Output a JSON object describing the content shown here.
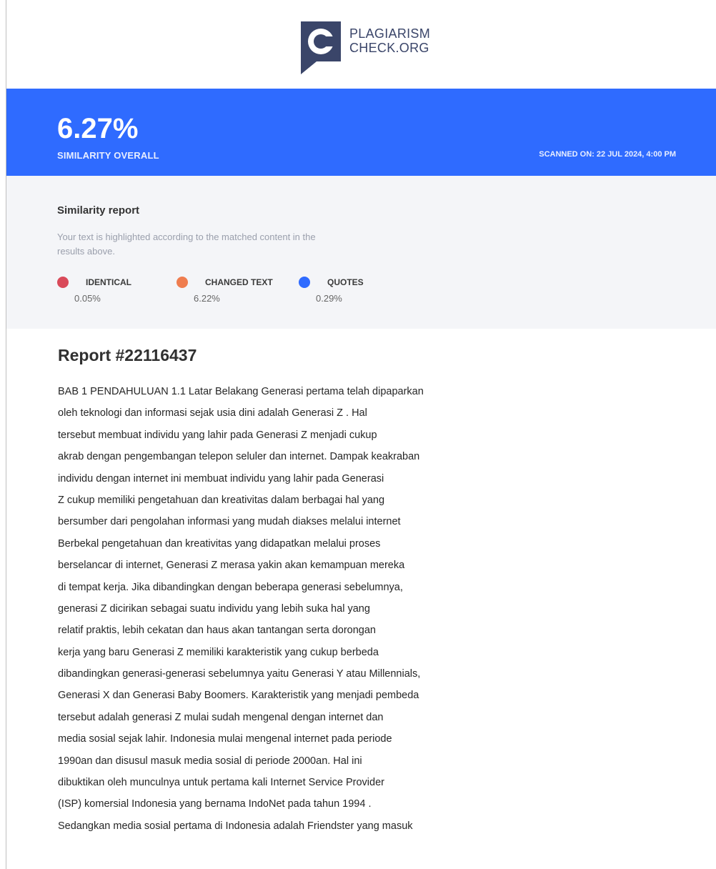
{
  "logo": {
    "line1": "PLAGIARISM",
    "line2": "CHECK.ORG",
    "brand_color": "#3a4569"
  },
  "banner": {
    "similarity": "6.27%",
    "similarity_label": "SIMILARITY OVERALL",
    "scanned": "SCANNED ON: 22 JUL 2024, 4:00 PM",
    "color": "#2f6bff"
  },
  "summary": {
    "title": "Similarity report",
    "description": "Your text is highlighted according to the matched content in the results above.",
    "legend": [
      {
        "label": "IDENTICAL",
        "value": "0.05%",
        "color": "#d94a5a",
        "progress": 0.05
      },
      {
        "label": "CHANGED TEXT",
        "value": "6.22%",
        "color": "#ef7d4f",
        "progress": 6.22
      },
      {
        "label": "QUOTES",
        "value": "0.29%",
        "color": "#2f6bff",
        "progress": 0.29
      }
    ]
  },
  "report": {
    "title": "Report #22116437",
    "lines": [
      "BAB 1 PENDAHULUAN 1.1 Latar Belakang Generasi pertama telah dipaparkan",
      "oleh teknologi dan informasi sejak usia dini adalah Generasi Z . Hal",
      "tersebut membuat individu yang lahir pada Generasi Z menjadi cukup",
      "akrab dengan pengembangan telepon seluler dan internet. Dampak keakraban",
      "individu dengan internet ini membuat individu yang lahir pada Generasi",
      "Z cukup memiliki pengetahuan dan kreativitas dalam berbagai hal yang",
      "bersumber dari pengolahan informasi yang mudah diakses melalui internet",
      "Berbekal pengetahuan dan kreativitas yang didapatkan melalui proses",
      "berselancar di internet, Generasi Z merasa yakin akan kemampuan mereka",
      "di tempat kerja. Jika dibandingkan dengan beberapa generasi sebelumnya,",
      "generasi Z dicirikan sebagai suatu individu yang lebih suka hal yang",
      "relatif praktis, lebih cekatan dan haus akan tantangan serta dorongan",
      "kerja yang baru Generasi Z memiliki karakteristik yang cukup berbeda",
      "dibandingkan generasi-generasi sebelumnya yaitu Generasi Y atau Millennials,",
      "Generasi X dan Generasi Baby Boomers. Karakteristik yang menjadi pembeda",
      "tersebut adalah generasi Z mulai sudah mengenal dengan internet dan",
      "media sosial sejak lahir. Indonesia mulai mengenal internet pada periode",
      "1990an dan disusul masuk media sosial di periode 2000an. Hal ini",
      "dibuktikan oleh munculnya untuk pertama kali Internet Service Provider",
      "(ISP) komersial Indonesia yang bernama IndoNet pada tahun 1994 .",
      "Sedangkan media sosial pertama di Indonesia adalah Friendster yang masuk"
    ]
  }
}
